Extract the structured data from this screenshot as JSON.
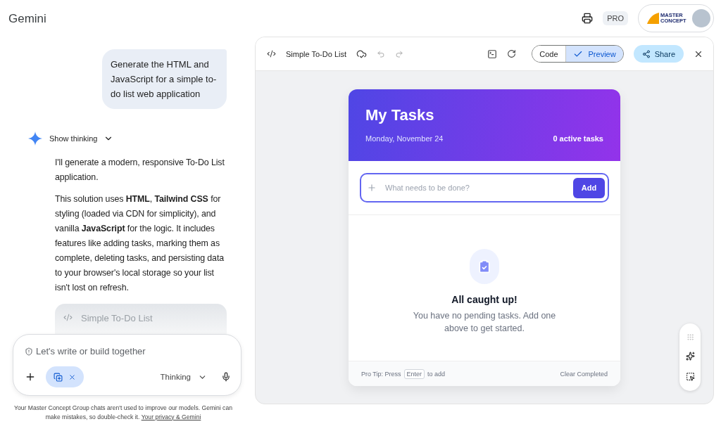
{
  "app": {
    "title": "Gemini",
    "plan": "PRO",
    "logo_lines": [
      "MASTER",
      "CONCEPT"
    ]
  },
  "chat": {
    "user_message": "Generate the HTML and JavaScript for a simple to-do list web application",
    "thinking": {
      "label": "Show thinking",
      "expanded": false
    },
    "paragraphs": [
      "I'll generate a modern, responsive To-Do List application.",
      "This solution uses **HTML**, **Tailwind CSS** for styling (loaded via CDN for simplicity), and vanilla **JavaScript** for the logic. It includes features like adding tasks, marking them as complete, deleting tasks, and persisting data to your browser's local storage so your list isn't lost on refresh."
    ],
    "artifact_card": {
      "title": "Simple To-Do List"
    }
  },
  "composer": {
    "placeholder": "Let's write or build together",
    "mode": "Thinking"
  },
  "disclaimer": {
    "text": "Your Master Concept Group chats aren't used to improve our models. Gemini can make mistakes, so double-check it.",
    "link": "Your privacy & Gemini"
  },
  "canvas": {
    "title": "Simple To-Do List",
    "view_toggle": [
      {
        "label": "Code",
        "selected": false
      },
      {
        "label": "Preview",
        "selected": true
      }
    ],
    "share": "Share"
  },
  "todo_app": {
    "heading": "My Tasks",
    "date": "Monday, November 24",
    "count": "0 active tasks",
    "input": {
      "placeholder": "What needs to be done?",
      "button": "Add"
    },
    "empty": {
      "title": "All caught up!",
      "message": "You have no pending tasks. Add one above to get started."
    },
    "footer": {
      "tip_before": "Pro Tip: Press",
      "key": "Enter",
      "tip_after": "to add",
      "clear": "Clear Completed"
    }
  }
}
